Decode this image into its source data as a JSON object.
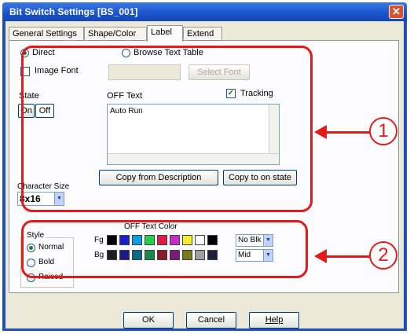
{
  "window": {
    "title": "Bit Switch Settings [BS_001]"
  },
  "tabs": [
    {
      "label": "General Settings"
    },
    {
      "label": "Shape/Color"
    },
    {
      "label": "Label"
    },
    {
      "label": "Extend"
    }
  ],
  "label_tab": {
    "direct_label": "Direct",
    "browse_label": "Browse Text Table",
    "image_font_label": "Image Font",
    "select_font_label": "Select Font",
    "state_label": "State",
    "state_on": "On",
    "state_off": "Off",
    "off_text_label": "OFF Text",
    "tracking_label": "Tracking",
    "off_text_value": "Auto Run",
    "copy_from_desc": "Copy from Description",
    "copy_to_on": "Copy to on state",
    "char_size_label": "Character Size",
    "char_size_value": "8x16",
    "off_text_color_label": "OFF Text Color",
    "style_label": "Style",
    "style_options": [
      {
        "label": "Normal",
        "selected": true
      },
      {
        "label": "Bold",
        "selected": false
      },
      {
        "label": "Raised",
        "selected": false
      }
    ],
    "fg_label": "Fg",
    "bg_label": "Bg",
    "fg_blink": "No Blk",
    "bg_blink": "Mid",
    "fg_colors": [
      "#000000",
      "#1c1cc8",
      "#0aa0e0",
      "#22d04a",
      "#e11b4a",
      "#c82cc8",
      "#f5ee2a",
      "#ffffff",
      "#000000"
    ],
    "bg_colors": [
      "#1e1e1e",
      "#1a1a8c",
      "#0a6a8a",
      "#168a4a",
      "#8a1a2a",
      "#7a1a7a",
      "#7a7a1a",
      "#a0a0a0",
      "#1e1e40"
    ]
  },
  "buttons": {
    "ok": "OK",
    "cancel": "Cancel",
    "help": "Help"
  },
  "annotations": {
    "callout_1": "1",
    "callout_2": "2"
  },
  "colors": {
    "accent": "#e21a1a",
    "titlebar": "#1f4fb8",
    "dialog_bg": "#ece9d8"
  }
}
